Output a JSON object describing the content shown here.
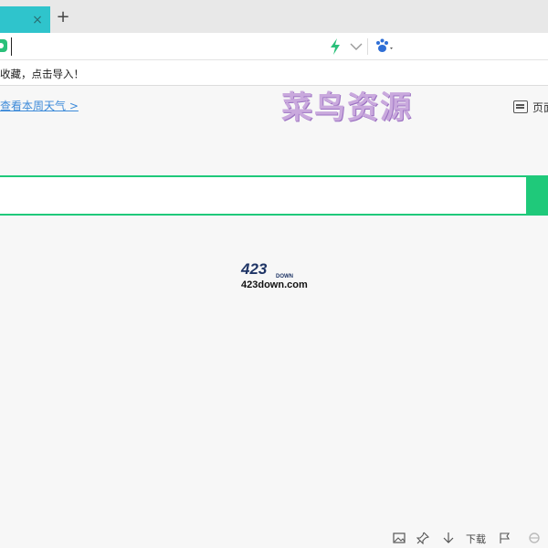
{
  "tab": {
    "close_label": "×",
    "new_tab_label": "+"
  },
  "address": {
    "value": "",
    "placeholder": ""
  },
  "bookmark_bar": {
    "hint": "收藏，点击导入！"
  },
  "content": {
    "weather_link": "查看本周天气 >",
    "watermark": "菜鸟资源",
    "page_button_label": "页面"
  },
  "search": {
    "value": "",
    "placeholder": ""
  },
  "logo": {
    "top_text": "423",
    "middle_text": "DOWN",
    "bottom_text": "423down.com"
  },
  "statusbar": {
    "download_label": "下载"
  },
  "colors": {
    "accent_green": "#1fc97a",
    "tab_cyan": "#2fc4cc",
    "link_blue": "#3c8ad9"
  }
}
